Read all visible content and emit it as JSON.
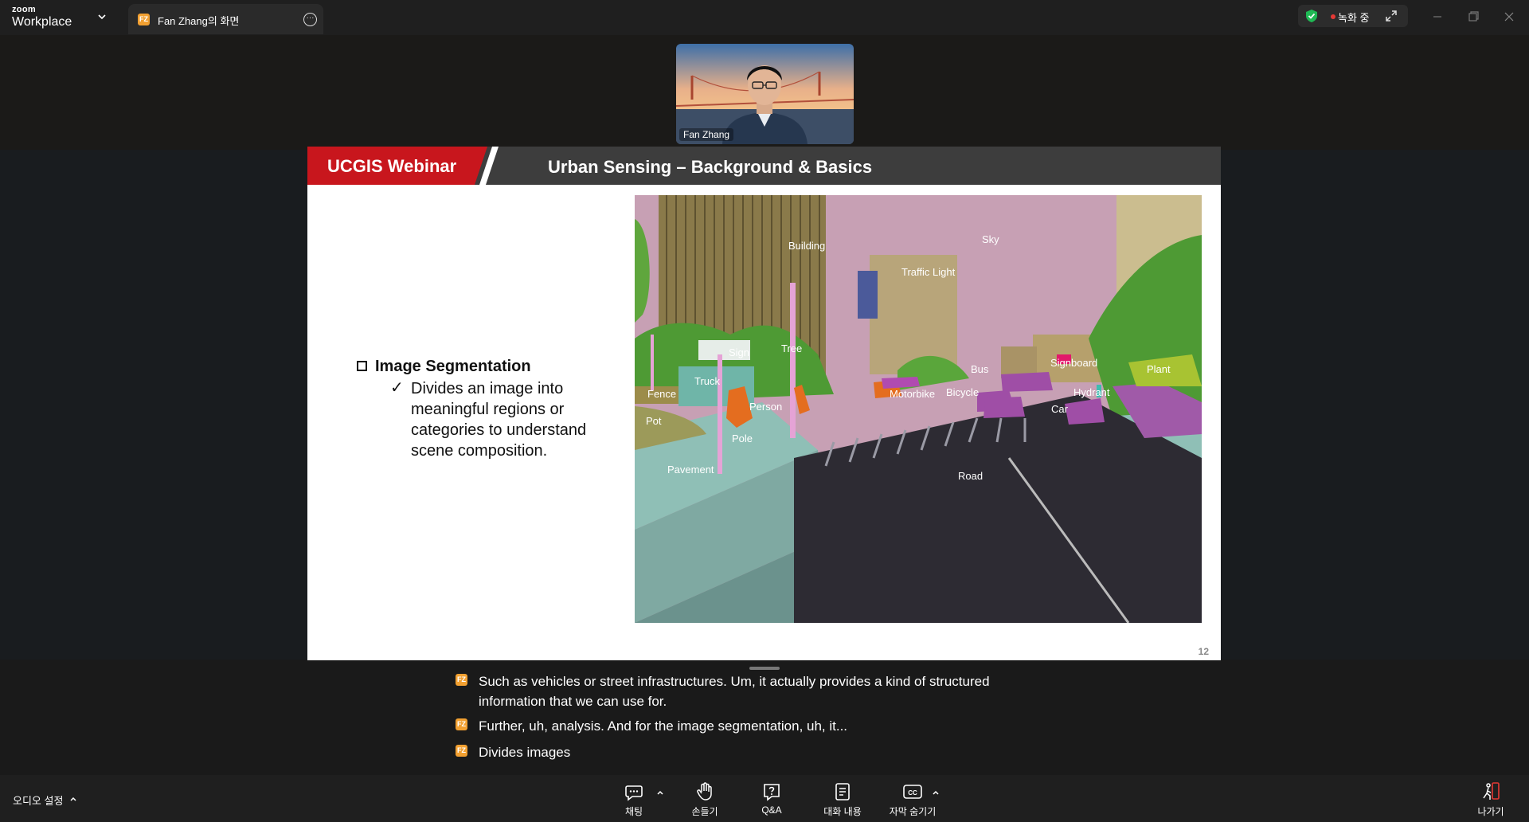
{
  "titlebar": {
    "brand_small": "zoom",
    "brand_big": "Workplace",
    "tab_avatar": "FZ",
    "tab_label": "Fan Zhang의 화면",
    "recording_label": "녹화 중",
    "icons": [
      "chevron-down-icon",
      "more-icon",
      "shield-check-icon",
      "expand-icon",
      "minimize-icon",
      "restore-icon",
      "close-icon"
    ]
  },
  "video": {
    "name": "Fan Zhang"
  },
  "slide": {
    "brand": "UCGIS Webinar",
    "title": "Urban Sensing – Background & Basics",
    "bullet_title": "Image Segmentation",
    "check": "✓",
    "bullet_text": "Divides an image into meaningful regions or categories to understand scene composition.",
    "page_number": "12",
    "segment_labels": [
      "Building",
      "Sky",
      "Traffic Light",
      "Sign",
      "Tree",
      "Truck",
      "Fence",
      "Person",
      "Pot",
      "Pole",
      "Pavement",
      "Motorbike",
      "Bicycle",
      "Bus",
      "Signboard",
      "Plant",
      "Hydrant",
      "Car",
      "Road"
    ]
  },
  "captions": [
    {
      "avatar": "FZ",
      "text": "Such as vehicles or street infrastructures. Um, it actually provides a kind of structured information that we can use for."
    },
    {
      "avatar": "FZ",
      "text": "Further, uh, analysis. And for the image segmentation, uh, it..."
    },
    {
      "avatar": "FZ",
      "text": "Divides images"
    }
  ],
  "toolbar": {
    "audio_label": "오디오 설정",
    "chat": "채팅",
    "raise_hand": "손들기",
    "qa": "Q&A",
    "transcript": "대화 내용",
    "captions": "자막 숨기기",
    "leave": "나가기"
  },
  "colors": {
    "brand_red": "#c8161d",
    "avatar_orange": "#f2a031",
    "recording_red": "#e53935",
    "shield_green": "#1fb954"
  }
}
